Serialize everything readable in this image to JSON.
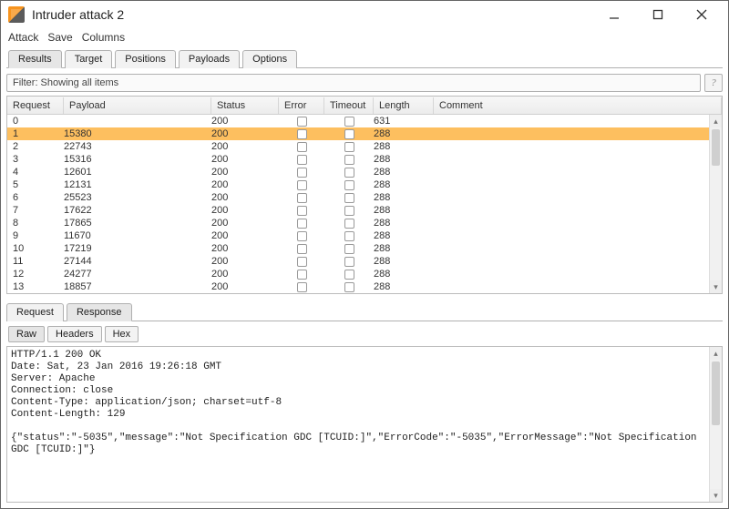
{
  "window": {
    "title": "Intruder attack 2"
  },
  "menu": {
    "items": [
      "Attack",
      "Save",
      "Columns"
    ]
  },
  "tabs": [
    "Results",
    "Target",
    "Positions",
    "Payloads",
    "Options"
  ],
  "filter": {
    "text": "Filter: Showing all items"
  },
  "table": {
    "headers": [
      "Request",
      "Payload",
      "Status",
      "Error",
      "Timeout",
      "Length",
      "Comment"
    ],
    "rows": [
      {
        "request": "0",
        "payload": "",
        "status": "200",
        "length": "631",
        "selected": false
      },
      {
        "request": "1",
        "payload": "15380",
        "status": "200",
        "length": "288",
        "selected": true
      },
      {
        "request": "2",
        "payload": "22743",
        "status": "200",
        "length": "288",
        "selected": false
      },
      {
        "request": "3",
        "payload": "15316",
        "status": "200",
        "length": "288",
        "selected": false
      },
      {
        "request": "4",
        "payload": "12601",
        "status": "200",
        "length": "288",
        "selected": false
      },
      {
        "request": "5",
        "payload": "12131",
        "status": "200",
        "length": "288",
        "selected": false
      },
      {
        "request": "6",
        "payload": "25523",
        "status": "200",
        "length": "288",
        "selected": false
      },
      {
        "request": "7",
        "payload": "17622",
        "status": "200",
        "length": "288",
        "selected": false
      },
      {
        "request": "8",
        "payload": "17865",
        "status": "200",
        "length": "288",
        "selected": false
      },
      {
        "request": "9",
        "payload": "11670",
        "status": "200",
        "length": "288",
        "selected": false
      },
      {
        "request": "10",
        "payload": "17219",
        "status": "200",
        "length": "288",
        "selected": false
      },
      {
        "request": "11",
        "payload": "27144",
        "status": "200",
        "length": "288",
        "selected": false
      },
      {
        "request": "12",
        "payload": "24277",
        "status": "200",
        "length": "288",
        "selected": false
      },
      {
        "request": "13",
        "payload": "18857",
        "status": "200",
        "length": "288",
        "selected": false
      }
    ]
  },
  "lower_tabs": [
    "Request",
    "Response"
  ],
  "sub_tabs": [
    "Raw",
    "Headers",
    "Hex"
  ],
  "response_raw": "HTTP/1.1 200 OK\nDate: Sat, 23 Jan 2016 19:26:18 GMT\nServer: Apache\nConnection: close\nContent-Type: application/json; charset=utf-8\nContent-Length: 129\n\n{\"status\":\"-5035\",\"message\":\"Not Specification GDC [TCUID:]\",\"ErrorCode\":\"-5035\",\"ErrorMessage\":\"Not Specification GDC [TCUID:]\"}"
}
